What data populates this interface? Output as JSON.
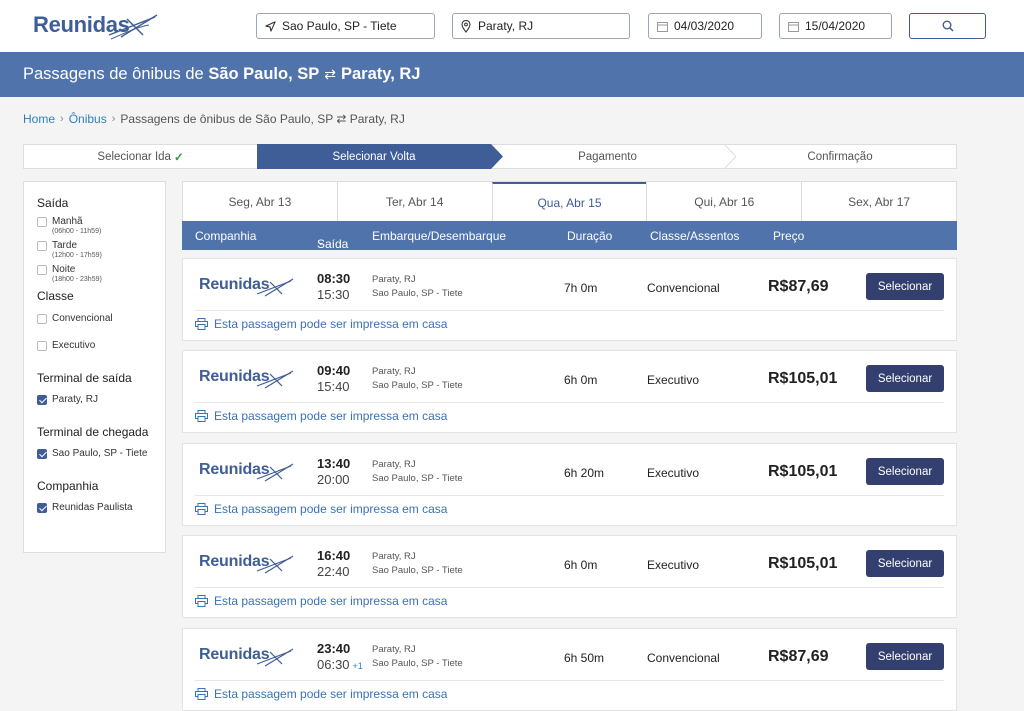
{
  "brand": {
    "name": "Reunidas",
    "color": "#3f5d97"
  },
  "search": {
    "origin": "Sao Paulo, SP - Tiete",
    "destination": "Paraty, RJ",
    "date_out": "04/03/2020",
    "date_return": "15/04/2020"
  },
  "banner": {
    "prefix": "Passagens de ônibus de",
    "origin": "São Paulo, SP",
    "swap": "⇄",
    "destination": "Paraty, RJ"
  },
  "breadcrumb": {
    "home": "Home",
    "bus": "Ônibus",
    "current": "Passagens de ônibus de São Paulo, SP ⇄ Paraty, RJ"
  },
  "steps": [
    {
      "label": "Selecionar Ida",
      "done": "✓"
    },
    {
      "label": "Selecionar Volta"
    },
    {
      "label": "Pagamento"
    },
    {
      "label": "Confirmação"
    }
  ],
  "filters": {
    "departure_title": "Saída",
    "morning": "Manhã",
    "morning_range": "(06h00 - 11h59)",
    "afternoon": "Tarde",
    "afternoon_range": "(12h00 - 17h59)",
    "night": "Noite",
    "night_range": "(18h00 - 23h59)",
    "class_title": "Classe",
    "conventional": "Convencional",
    "executive": "Executivo",
    "dep_terminal_title": "Terminal de saída",
    "dep_terminal": "Paraty, RJ",
    "arr_terminal_title": "Terminal de chegada",
    "arr_terminal": "Sao Paulo, SP - Tiete",
    "company_title": "Companhia",
    "company": "Reunidas Paulista"
  },
  "days": [
    "Seg, Abr 13",
    "Ter, Abr 14",
    "Qua, Abr 15",
    "Qui, Abr 16",
    "Sex, Abr 17"
  ],
  "table_headers": {
    "company": "Companhia",
    "departure": "Saída",
    "sort_icon": "⌄",
    "route": "Embarque/Desembarque",
    "duration": "Duração",
    "class": "Classe/Assentos",
    "price": "Preço"
  },
  "trips": [
    {
      "dep": "08:30",
      "arr": "15:30",
      "plus": "",
      "origin": "Paraty, RJ",
      "destination": "Sao Paulo, SP - Tiete",
      "duration": "7h 0m",
      "class": "Convencional",
      "price": "R$87,69",
      "button": "Selecionar",
      "note": "Esta passagem pode ser impressa em casa"
    },
    {
      "dep": "09:40",
      "arr": "15:40",
      "plus": "",
      "origin": "Paraty, RJ",
      "destination": "Sao Paulo, SP - Tiete",
      "duration": "6h 0m",
      "class": "Executivo",
      "price": "R$105,01",
      "button": "Selecionar",
      "note": "Esta passagem pode ser impressa em casa"
    },
    {
      "dep": "13:40",
      "arr": "20:00",
      "plus": "",
      "origin": "Paraty, RJ",
      "destination": "Sao Paulo, SP - Tiete",
      "duration": "6h 20m",
      "class": "Executivo",
      "price": "R$105,01",
      "button": "Selecionar",
      "note": "Esta passagem pode ser impressa em casa"
    },
    {
      "dep": "16:40",
      "arr": "22:40",
      "plus": "",
      "origin": "Paraty, RJ",
      "destination": "Sao Paulo, SP - Tiete",
      "duration": "6h 0m",
      "class": "Executivo",
      "price": "R$105,01",
      "button": "Selecionar",
      "note": "Esta passagem pode ser impressa em casa"
    },
    {
      "dep": "23:40",
      "arr": "06:30",
      "plus": "+1",
      "origin": "Paraty, RJ",
      "destination": "Sao Paulo, SP - Tiete",
      "duration": "6h 50m",
      "class": "Convencional",
      "price": "R$87,69",
      "button": "Selecionar",
      "note": "Esta passagem pode ser impressa em casa"
    }
  ]
}
